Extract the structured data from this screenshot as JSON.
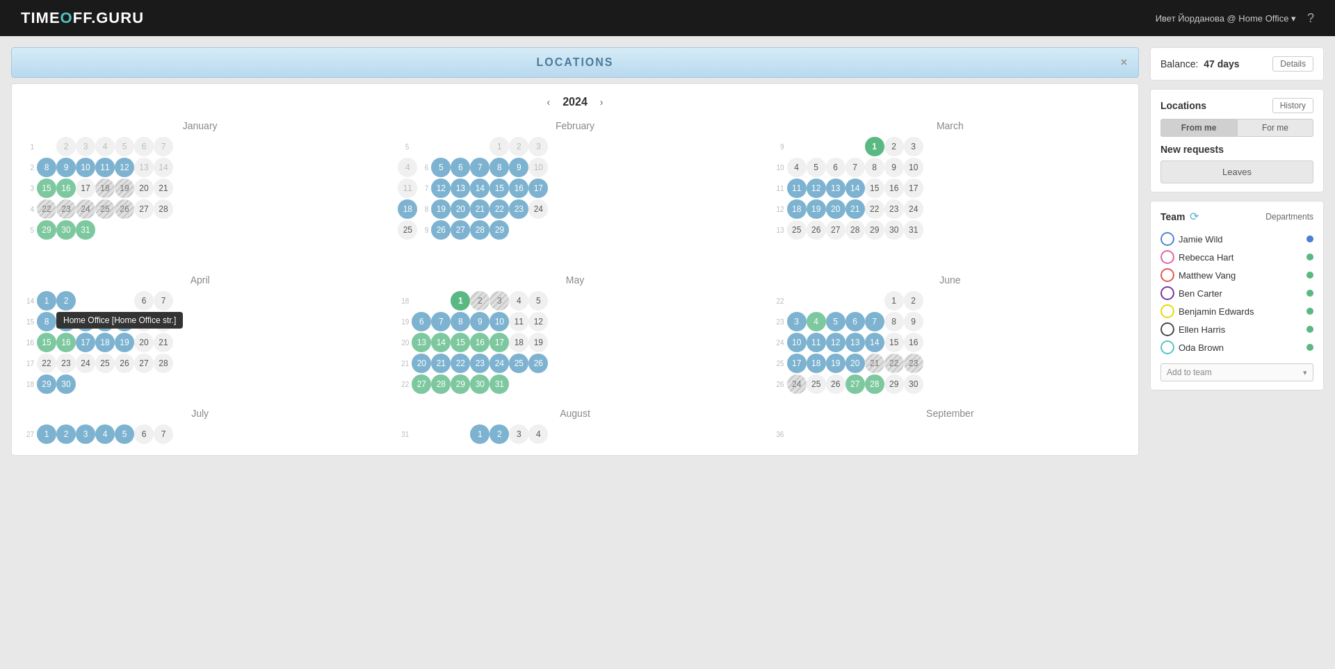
{
  "header": {
    "logo_text": "TIME",
    "logo_accent": "O",
    "logo_suffix": "FF.GURU",
    "user": "Ивет Йорданова @ Home Office ▾",
    "help_icon": "?"
  },
  "locations_bar": {
    "title": "LOCATIONS",
    "close": "×"
  },
  "year_nav": {
    "prev": "‹",
    "year": "2024",
    "next": "›"
  },
  "sidebar": {
    "balance_label": "Balance:",
    "balance_value": "47 days",
    "details_btn": "Details",
    "locations_label": "Locations",
    "history_btn": "History",
    "from_me_btn": "From me",
    "for_me_btn": "For me",
    "new_requests_label": "New requests",
    "leaves_btn": "Leaves",
    "team_label": "Team",
    "departments_btn": "Departments",
    "add_to_team_placeholder": "Add to team",
    "team_members": [
      {
        "name": "Jamie Wild",
        "color": "#4a7fd4",
        "dot": "blue"
      },
      {
        "name": "Rebecca Hart",
        "color": "#e060a0",
        "dot": "green"
      },
      {
        "name": "Matthew Vang",
        "color": "#e05050",
        "dot": "green"
      },
      {
        "name": "Ben Carter",
        "color": "#7030a0",
        "dot": "green"
      },
      {
        "name": "Benjamin Edwards",
        "color": "#e8d800",
        "dot": "green"
      },
      {
        "name": "Ellen Harris",
        "color": "#444444",
        "dot": "green"
      },
      {
        "name": "Oda Brown",
        "color": "#4fc3c3",
        "dot": "green"
      }
    ]
  },
  "tooltip": {
    "text": "Home Office [Home Office str.]"
  }
}
